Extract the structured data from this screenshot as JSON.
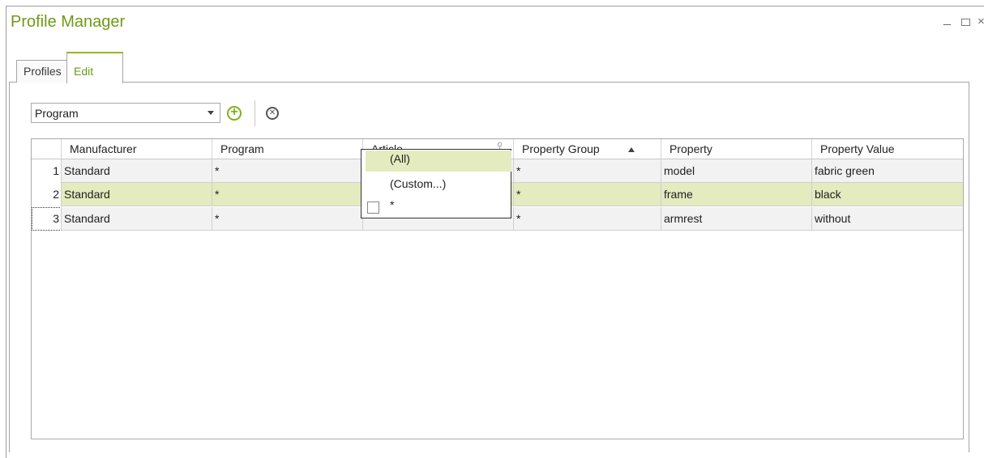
{
  "window": {
    "title": "Profile Manager",
    "controls": {
      "minimize": "_",
      "maximize": "□",
      "close": "×"
    }
  },
  "tabs": [
    {
      "label": "Profiles",
      "active": false
    },
    {
      "label": "Edit",
      "active": true
    }
  ],
  "toolbar": {
    "combo_value": "Program",
    "add_icon": "plus-circle-icon",
    "delete_icon": "close-circle-icon"
  },
  "grid": {
    "columns": [
      "Manufacturer",
      "Program",
      "Article",
      "Property Group",
      "Property",
      "Property Value"
    ],
    "sorted_column": "Property Group",
    "sort_direction": "ascending",
    "rows": [
      {
        "num": "1",
        "manufacturer": "Standard",
        "program": "*",
        "article": "",
        "property_group": "*",
        "property": "model",
        "property_value": "fabric green"
      },
      {
        "num": "2",
        "manufacturer": "Standard",
        "program": "*",
        "article": "",
        "property_group": "*",
        "property": "frame",
        "property_value": "black"
      },
      {
        "num": "3",
        "manufacturer": "Standard",
        "program": "*",
        "article": "",
        "property_group": "*",
        "property": "armrest",
        "property_value": "without"
      }
    ],
    "selected_row": 2
  },
  "filter_dropdown": {
    "items": [
      "(All)",
      "(Custom...)",
      "*"
    ],
    "highlighted": "(All)"
  },
  "colors": {
    "accent": "#6e9a16",
    "selection": "#e3ebbf"
  }
}
